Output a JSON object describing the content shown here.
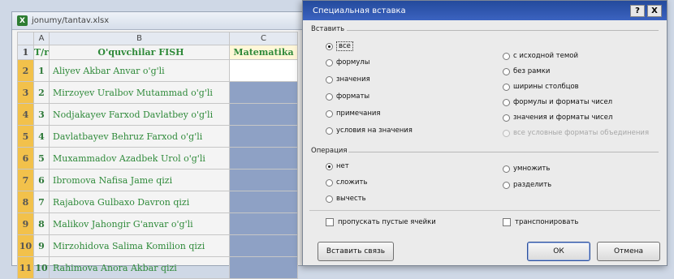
{
  "sheet": {
    "file_name": "jonumy/tantav.xlsx",
    "column_headers": [
      "A",
      "B",
      "C"
    ],
    "header_row": {
      "num": "T/r",
      "name": "O'quvchilar FISH",
      "subject": "Matematika"
    },
    "row_numbers": [
      "1",
      "2",
      "3",
      "4",
      "5",
      "6",
      "7",
      "8",
      "9",
      "10",
      "11"
    ],
    "students": [
      {
        "num": "1",
        "name": "Aliyev Akbar Anvar o'g'li"
      },
      {
        "num": "2",
        "name": "Mirzoyev Uralbov Mutammad o'g'li"
      },
      {
        "num": "3",
        "name": "Nodjakayev Farxod Davlatbey o'g'li"
      },
      {
        "num": "4",
        "name": "Davlatbayev Behruz Farxod o'g'li"
      },
      {
        "num": "5",
        "name": "Muxammadov Azadbek Urol o'g'li"
      },
      {
        "num": "6",
        "name": "Ibromova Nafisa Jame qizi"
      },
      {
        "num": "7",
        "name": "Rajabova Gulbaxo Davron qizi"
      },
      {
        "num": "8",
        "name": "Malikov Jahongir G'anvar o'g'li"
      },
      {
        "num": "9",
        "name": "Mirzohidova Salima Komilion qizi"
      },
      {
        "num": "10",
        "name": "Rahimova Anora Akbar qizi"
      }
    ]
  },
  "dialog": {
    "title": "Специальная вставка",
    "help_glyph": "?",
    "close_glyph": "X",
    "paste_group": {
      "label": "Вставить",
      "left": [
        "все",
        "формулы",
        "значения",
        "форматы",
        "примечания",
        "условия на значения"
      ],
      "right": [
        "с исходной темой",
        "без рамки",
        "ширины столбцов",
        "формулы и форматы чисел",
        "значения и форматы чисел",
        "все условные форматы объединения"
      ]
    },
    "operation_group": {
      "label": "Операция",
      "left": [
        "нет",
        "сложить",
        "вычесть"
      ],
      "right": [
        "умножить",
        "разделить"
      ]
    },
    "skip_blanks": "пропускать пустые ячейки",
    "transpose": "транспонировать",
    "paste_link_button": "Вставить связь",
    "ok_button": "ОК",
    "cancel_button": "Отмена"
  }
}
